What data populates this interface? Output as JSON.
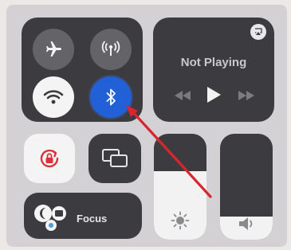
{
  "connectivity": {
    "airplane": {
      "state": "off",
      "icon": "airplane-icon"
    },
    "cellular": {
      "state": "off",
      "icon": "antenna-icon"
    },
    "wifi": {
      "state": "on",
      "icon": "wifi-icon"
    },
    "bluetooth": {
      "state": "on",
      "icon": "bluetooth-icon",
      "highlight_color": "#2260d8"
    }
  },
  "now_playing": {
    "title": "Not Playing",
    "airplay_icon": "airplay-icon",
    "controls": [
      "rewind-icon",
      "play-icon",
      "fast-forward-icon"
    ]
  },
  "orientation_lock": {
    "icon": "rotation-lock-icon",
    "accent": "#d9323a"
  },
  "screen_mirroring": {
    "icon": "screen-mirroring-icon"
  },
  "focus": {
    "label": "Focus",
    "icon": "moon-icon"
  },
  "brightness": {
    "level": 0.65,
    "icon": "sun-icon"
  },
  "volume": {
    "level": 0.22,
    "icon": "speaker-icon"
  },
  "annotation_arrow": {
    "color": "#d8262e"
  }
}
